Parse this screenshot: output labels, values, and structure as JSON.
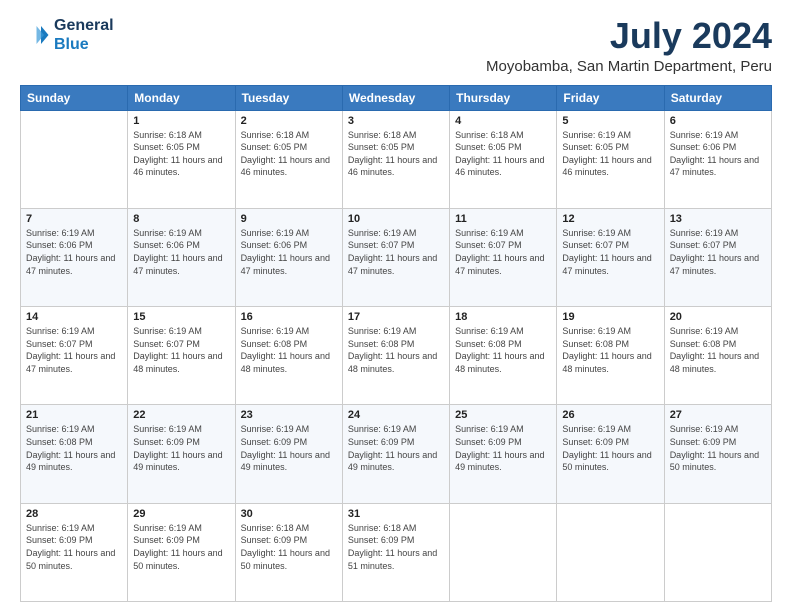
{
  "header": {
    "logo_line1": "General",
    "logo_line2": "Blue",
    "title": "July 2024",
    "subtitle": "Moyobamba, San Martin Department, Peru"
  },
  "days_header": [
    "Sunday",
    "Monday",
    "Tuesday",
    "Wednesday",
    "Thursday",
    "Friday",
    "Saturday"
  ],
  "weeks": [
    [
      {
        "day": "",
        "sunrise": "",
        "sunset": "",
        "daylight": ""
      },
      {
        "day": "1",
        "sunrise": "Sunrise: 6:18 AM",
        "sunset": "Sunset: 6:05 PM",
        "daylight": "Daylight: 11 hours and 46 minutes."
      },
      {
        "day": "2",
        "sunrise": "Sunrise: 6:18 AM",
        "sunset": "Sunset: 6:05 PM",
        "daylight": "Daylight: 11 hours and 46 minutes."
      },
      {
        "day": "3",
        "sunrise": "Sunrise: 6:18 AM",
        "sunset": "Sunset: 6:05 PM",
        "daylight": "Daylight: 11 hours and 46 minutes."
      },
      {
        "day": "4",
        "sunrise": "Sunrise: 6:18 AM",
        "sunset": "Sunset: 6:05 PM",
        "daylight": "Daylight: 11 hours and 46 minutes."
      },
      {
        "day": "5",
        "sunrise": "Sunrise: 6:19 AM",
        "sunset": "Sunset: 6:05 PM",
        "daylight": "Daylight: 11 hours and 46 minutes."
      },
      {
        "day": "6",
        "sunrise": "Sunrise: 6:19 AM",
        "sunset": "Sunset: 6:06 PM",
        "daylight": "Daylight: 11 hours and 47 minutes."
      }
    ],
    [
      {
        "day": "7",
        "sunrise": "Sunrise: 6:19 AM",
        "sunset": "Sunset: 6:06 PM",
        "daylight": "Daylight: 11 hours and 47 minutes."
      },
      {
        "day": "8",
        "sunrise": "Sunrise: 6:19 AM",
        "sunset": "Sunset: 6:06 PM",
        "daylight": "Daylight: 11 hours and 47 minutes."
      },
      {
        "day": "9",
        "sunrise": "Sunrise: 6:19 AM",
        "sunset": "Sunset: 6:06 PM",
        "daylight": "Daylight: 11 hours and 47 minutes."
      },
      {
        "day": "10",
        "sunrise": "Sunrise: 6:19 AM",
        "sunset": "Sunset: 6:07 PM",
        "daylight": "Daylight: 11 hours and 47 minutes."
      },
      {
        "day": "11",
        "sunrise": "Sunrise: 6:19 AM",
        "sunset": "Sunset: 6:07 PM",
        "daylight": "Daylight: 11 hours and 47 minutes."
      },
      {
        "day": "12",
        "sunrise": "Sunrise: 6:19 AM",
        "sunset": "Sunset: 6:07 PM",
        "daylight": "Daylight: 11 hours and 47 minutes."
      },
      {
        "day": "13",
        "sunrise": "Sunrise: 6:19 AM",
        "sunset": "Sunset: 6:07 PM",
        "daylight": "Daylight: 11 hours and 47 minutes."
      }
    ],
    [
      {
        "day": "14",
        "sunrise": "Sunrise: 6:19 AM",
        "sunset": "Sunset: 6:07 PM",
        "daylight": "Daylight: 11 hours and 47 minutes."
      },
      {
        "day": "15",
        "sunrise": "Sunrise: 6:19 AM",
        "sunset": "Sunset: 6:07 PM",
        "daylight": "Daylight: 11 hours and 48 minutes."
      },
      {
        "day": "16",
        "sunrise": "Sunrise: 6:19 AM",
        "sunset": "Sunset: 6:08 PM",
        "daylight": "Daylight: 11 hours and 48 minutes."
      },
      {
        "day": "17",
        "sunrise": "Sunrise: 6:19 AM",
        "sunset": "Sunset: 6:08 PM",
        "daylight": "Daylight: 11 hours and 48 minutes."
      },
      {
        "day": "18",
        "sunrise": "Sunrise: 6:19 AM",
        "sunset": "Sunset: 6:08 PM",
        "daylight": "Daylight: 11 hours and 48 minutes."
      },
      {
        "day": "19",
        "sunrise": "Sunrise: 6:19 AM",
        "sunset": "Sunset: 6:08 PM",
        "daylight": "Daylight: 11 hours and 48 minutes."
      },
      {
        "day": "20",
        "sunrise": "Sunrise: 6:19 AM",
        "sunset": "Sunset: 6:08 PM",
        "daylight": "Daylight: 11 hours and 48 minutes."
      }
    ],
    [
      {
        "day": "21",
        "sunrise": "Sunrise: 6:19 AM",
        "sunset": "Sunset: 6:08 PM",
        "daylight": "Daylight: 11 hours and 49 minutes."
      },
      {
        "day": "22",
        "sunrise": "Sunrise: 6:19 AM",
        "sunset": "Sunset: 6:09 PM",
        "daylight": "Daylight: 11 hours and 49 minutes."
      },
      {
        "day": "23",
        "sunrise": "Sunrise: 6:19 AM",
        "sunset": "Sunset: 6:09 PM",
        "daylight": "Daylight: 11 hours and 49 minutes."
      },
      {
        "day": "24",
        "sunrise": "Sunrise: 6:19 AM",
        "sunset": "Sunset: 6:09 PM",
        "daylight": "Daylight: 11 hours and 49 minutes."
      },
      {
        "day": "25",
        "sunrise": "Sunrise: 6:19 AM",
        "sunset": "Sunset: 6:09 PM",
        "daylight": "Daylight: 11 hours and 49 minutes."
      },
      {
        "day": "26",
        "sunrise": "Sunrise: 6:19 AM",
        "sunset": "Sunset: 6:09 PM",
        "daylight": "Daylight: 11 hours and 50 minutes."
      },
      {
        "day": "27",
        "sunrise": "Sunrise: 6:19 AM",
        "sunset": "Sunset: 6:09 PM",
        "daylight": "Daylight: 11 hours and 50 minutes."
      }
    ],
    [
      {
        "day": "28",
        "sunrise": "Sunrise: 6:19 AM",
        "sunset": "Sunset: 6:09 PM",
        "daylight": "Daylight: 11 hours and 50 minutes."
      },
      {
        "day": "29",
        "sunrise": "Sunrise: 6:19 AM",
        "sunset": "Sunset: 6:09 PM",
        "daylight": "Daylight: 11 hours and 50 minutes."
      },
      {
        "day": "30",
        "sunrise": "Sunrise: 6:18 AM",
        "sunset": "Sunset: 6:09 PM",
        "daylight": "Daylight: 11 hours and 50 minutes."
      },
      {
        "day": "31",
        "sunrise": "Sunrise: 6:18 AM",
        "sunset": "Sunset: 6:09 PM",
        "daylight": "Daylight: 11 hours and 51 minutes."
      },
      {
        "day": "",
        "sunrise": "",
        "sunset": "",
        "daylight": ""
      },
      {
        "day": "",
        "sunrise": "",
        "sunset": "",
        "daylight": ""
      },
      {
        "day": "",
        "sunrise": "",
        "sunset": "",
        "daylight": ""
      }
    ]
  ]
}
